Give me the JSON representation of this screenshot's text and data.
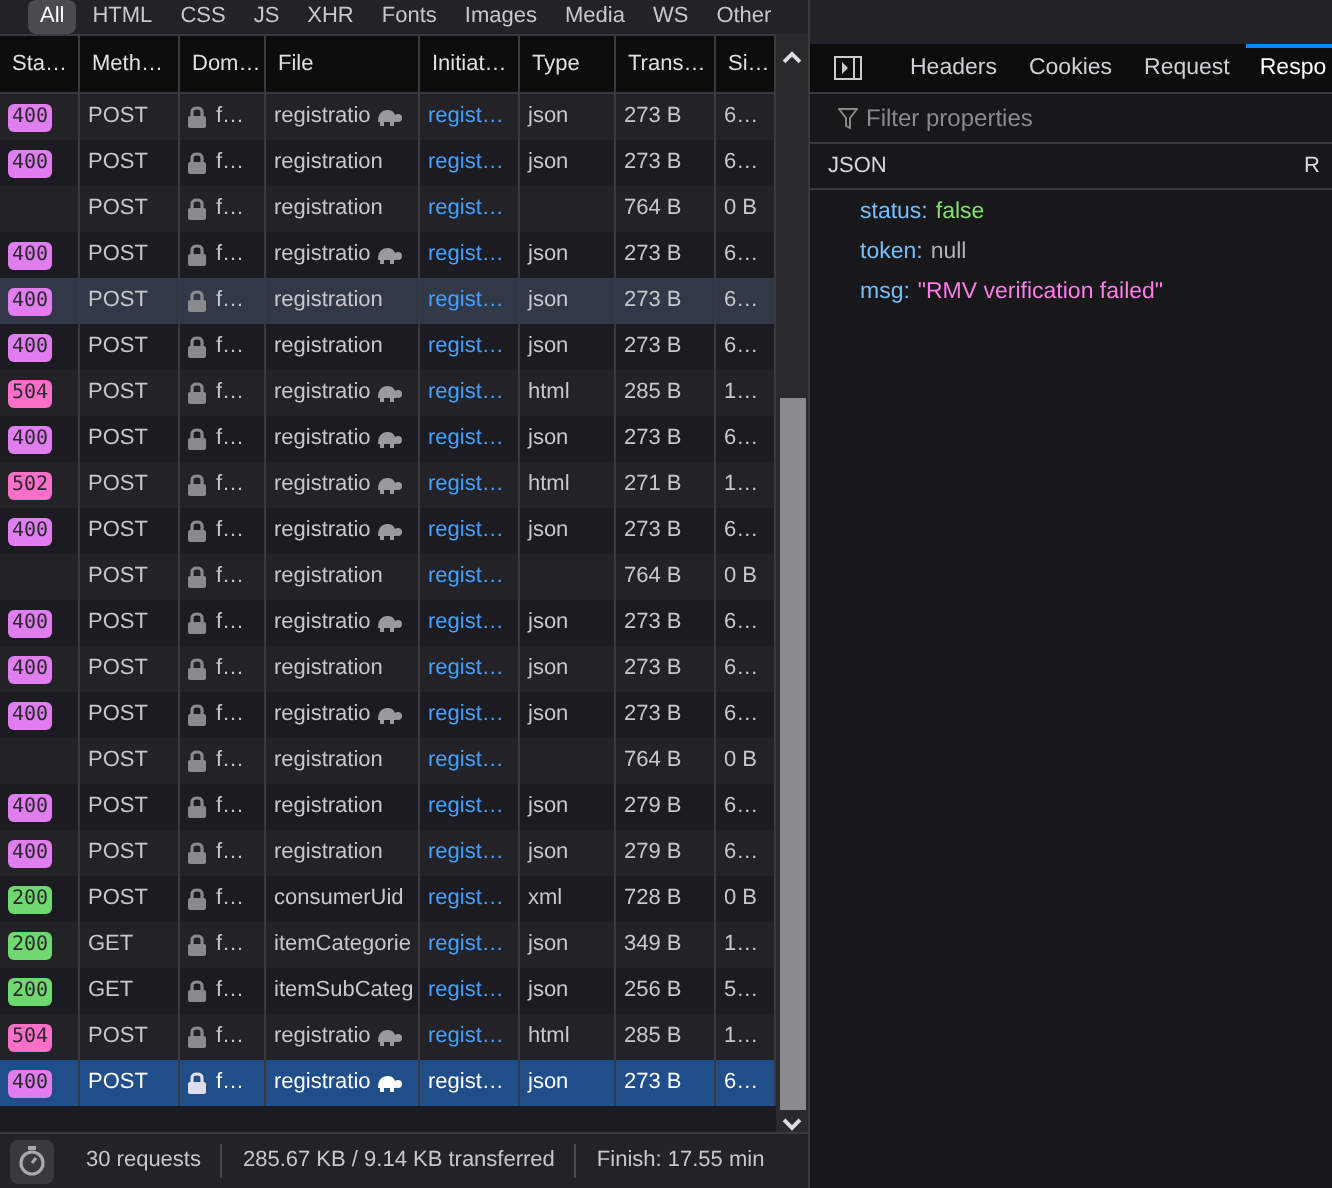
{
  "filter_tabs": [
    {
      "label": "All",
      "selected": true
    },
    {
      "label": "HTML",
      "selected": false
    },
    {
      "label": "CSS",
      "selected": false
    },
    {
      "label": "JS",
      "selected": false
    },
    {
      "label": "XHR",
      "selected": false
    },
    {
      "label": "Fonts",
      "selected": false
    },
    {
      "label": "Images",
      "selected": false
    },
    {
      "label": "Media",
      "selected": false
    },
    {
      "label": "WS",
      "selected": false
    },
    {
      "label": "Other",
      "selected": false
    }
  ],
  "table": {
    "columns": [
      "Sta…",
      "Meth…",
      "Dom…",
      "File",
      "Initiat…",
      "Type",
      "Trans…",
      "Si…"
    ],
    "rows": [
      {
        "status": "400",
        "color": "#e07ef0",
        "method": "POST",
        "domain": "f…",
        "file": "registratio",
        "slow": true,
        "initiator": "regist…",
        "type": "json",
        "transferred": "273 B",
        "size": "6…",
        "selected": false,
        "hovered": false
      },
      {
        "status": "400",
        "color": "#e07ef0",
        "method": "POST",
        "domain": "f…",
        "file": "registration",
        "slow": false,
        "initiator": "regist…",
        "type": "json",
        "transferred": "273 B",
        "size": "6…",
        "selected": false,
        "hovered": false
      },
      {
        "status": "",
        "method": "POST",
        "domain": "f…",
        "file": "registration",
        "slow": false,
        "initiator": "regist…",
        "type": "",
        "transferred": "764 B",
        "size": "0 B",
        "selected": false,
        "hovered": false
      },
      {
        "status": "400",
        "color": "#e07ef0",
        "method": "POST",
        "domain": "f…",
        "file": "registratio",
        "slow": true,
        "initiator": "regist…",
        "type": "json",
        "transferred": "273 B",
        "size": "6…",
        "selected": false,
        "hovered": false
      },
      {
        "status": "400",
        "color": "#e07ef0",
        "method": "POST",
        "domain": "f…",
        "file": "registration",
        "slow": false,
        "initiator": "regist…",
        "type": "json",
        "transferred": "273 B",
        "size": "6…",
        "selected": false,
        "hovered": true
      },
      {
        "status": "400",
        "color": "#e07ef0",
        "method": "POST",
        "domain": "f…",
        "file": "registration",
        "slow": false,
        "initiator": "regist…",
        "type": "json",
        "transferred": "273 B",
        "size": "6…",
        "selected": false,
        "hovered": false
      },
      {
        "status": "504",
        "color": "#ff6ec9",
        "method": "POST",
        "domain": "f…",
        "file": "registratio",
        "slow": true,
        "initiator": "regist…",
        "type": "html",
        "transferred": "285 B",
        "size": "1…",
        "selected": false,
        "hovered": false
      },
      {
        "status": "400",
        "color": "#e07ef0",
        "method": "POST",
        "domain": "f…",
        "file": "registratio",
        "slow": true,
        "initiator": "regist…",
        "type": "json",
        "transferred": "273 B",
        "size": "6…",
        "selected": false,
        "hovered": false
      },
      {
        "status": "502",
        "color": "#ff6ec9",
        "method": "POST",
        "domain": "f…",
        "file": "registratio",
        "slow": true,
        "initiator": "regist…",
        "type": "html",
        "transferred": "271 B",
        "size": "1…",
        "selected": false,
        "hovered": false
      },
      {
        "status": "400",
        "color": "#e07ef0",
        "method": "POST",
        "domain": "f…",
        "file": "registratio",
        "slow": true,
        "initiator": "regist…",
        "type": "json",
        "transferred": "273 B",
        "size": "6…",
        "selected": false,
        "hovered": false
      },
      {
        "status": "",
        "method": "POST",
        "domain": "f…",
        "file": "registration",
        "slow": false,
        "initiator": "regist…",
        "type": "",
        "transferred": "764 B",
        "size": "0 B",
        "selected": false,
        "hovered": false
      },
      {
        "status": "400",
        "color": "#e07ef0",
        "method": "POST",
        "domain": "f…",
        "file": "registratio",
        "slow": true,
        "initiator": "regist…",
        "type": "json",
        "transferred": "273 B",
        "size": "6…",
        "selected": false,
        "hovered": false
      },
      {
        "status": "400",
        "color": "#e07ef0",
        "method": "POST",
        "domain": "f…",
        "file": "registration",
        "slow": false,
        "initiator": "regist…",
        "type": "json",
        "transferred": "273 B",
        "size": "6…",
        "selected": false,
        "hovered": false
      },
      {
        "status": "400",
        "color": "#e07ef0",
        "method": "POST",
        "domain": "f…",
        "file": "registratio",
        "slow": true,
        "initiator": "regist…",
        "type": "json",
        "transferred": "273 B",
        "size": "6…",
        "selected": false,
        "hovered": false
      },
      {
        "status": "",
        "method": "POST",
        "domain": "f…",
        "file": "registration",
        "slow": false,
        "initiator": "regist…",
        "type": "",
        "transferred": "764 B",
        "size": "0 B",
        "selected": false,
        "hovered": false
      },
      {
        "status": "400",
        "color": "#e07ef0",
        "method": "POST",
        "domain": "f…",
        "file": "registration",
        "slow": false,
        "initiator": "regist…",
        "type": "json",
        "transferred": "279 B",
        "size": "6…",
        "selected": false,
        "hovered": false
      },
      {
        "status": "400",
        "color": "#e07ef0",
        "method": "POST",
        "domain": "f…",
        "file": "registration",
        "slow": false,
        "initiator": "regist…",
        "type": "json",
        "transferred": "279 B",
        "size": "6…",
        "selected": false,
        "hovered": false
      },
      {
        "status": "200",
        "color": "#6fd86f",
        "method": "POST",
        "domain": "f…",
        "file": "consumerUid",
        "slow": false,
        "initiator": "regist…",
        "type": "xml",
        "transferred": "728 B",
        "size": "0 B",
        "selected": false,
        "hovered": false
      },
      {
        "status": "200",
        "color": "#6fd86f",
        "method": "GET",
        "domain": "f…",
        "file": "itemCategorie",
        "slow": false,
        "initiator": "regist…",
        "type": "json",
        "transferred": "349 B",
        "size": "1…",
        "selected": false,
        "hovered": false
      },
      {
        "status": "200",
        "color": "#6fd86f",
        "method": "GET",
        "domain": "f…",
        "file": "itemSubCateg",
        "slow": false,
        "initiator": "regist…",
        "type": "json",
        "transferred": "256 B",
        "size": "5…",
        "selected": false,
        "hovered": false
      },
      {
        "status": "504",
        "color": "#ff6ec9",
        "method": "POST",
        "domain": "f…",
        "file": "registratio",
        "slow": true,
        "initiator": "regist…",
        "type": "html",
        "transferred": "285 B",
        "size": "1…",
        "selected": false,
        "hovered": false
      },
      {
        "status": "400",
        "color": "#e07ef0",
        "method": "POST",
        "domain": "f…",
        "file": "registratio",
        "slow": true,
        "initiator": "regist…",
        "type": "json",
        "transferred": "273 B",
        "size": "6…",
        "selected": true,
        "hovered": false
      }
    ]
  },
  "status_bar": {
    "requests": "30 requests",
    "transferred": "285.67 KB / 9.14 KB transferred",
    "finish": "Finish: 17.55 min"
  },
  "details": {
    "tabs": [
      {
        "label": "Headers",
        "selected": false
      },
      {
        "label": "Cookies",
        "selected": false
      },
      {
        "label": "Request",
        "selected": false
      },
      {
        "label": "Respo",
        "selected": true
      }
    ],
    "filter": {
      "placeholder": "Filter properties"
    },
    "section_title": "JSON",
    "section_toggle": "R",
    "properties": [
      {
        "key": "status:",
        "value": "false",
        "kind": "boolean"
      },
      {
        "key": "token:",
        "value": "null",
        "kind": "null"
      },
      {
        "key": "msg:",
        "value": "\"RMV verification failed\"",
        "kind": "string"
      }
    ]
  }
}
